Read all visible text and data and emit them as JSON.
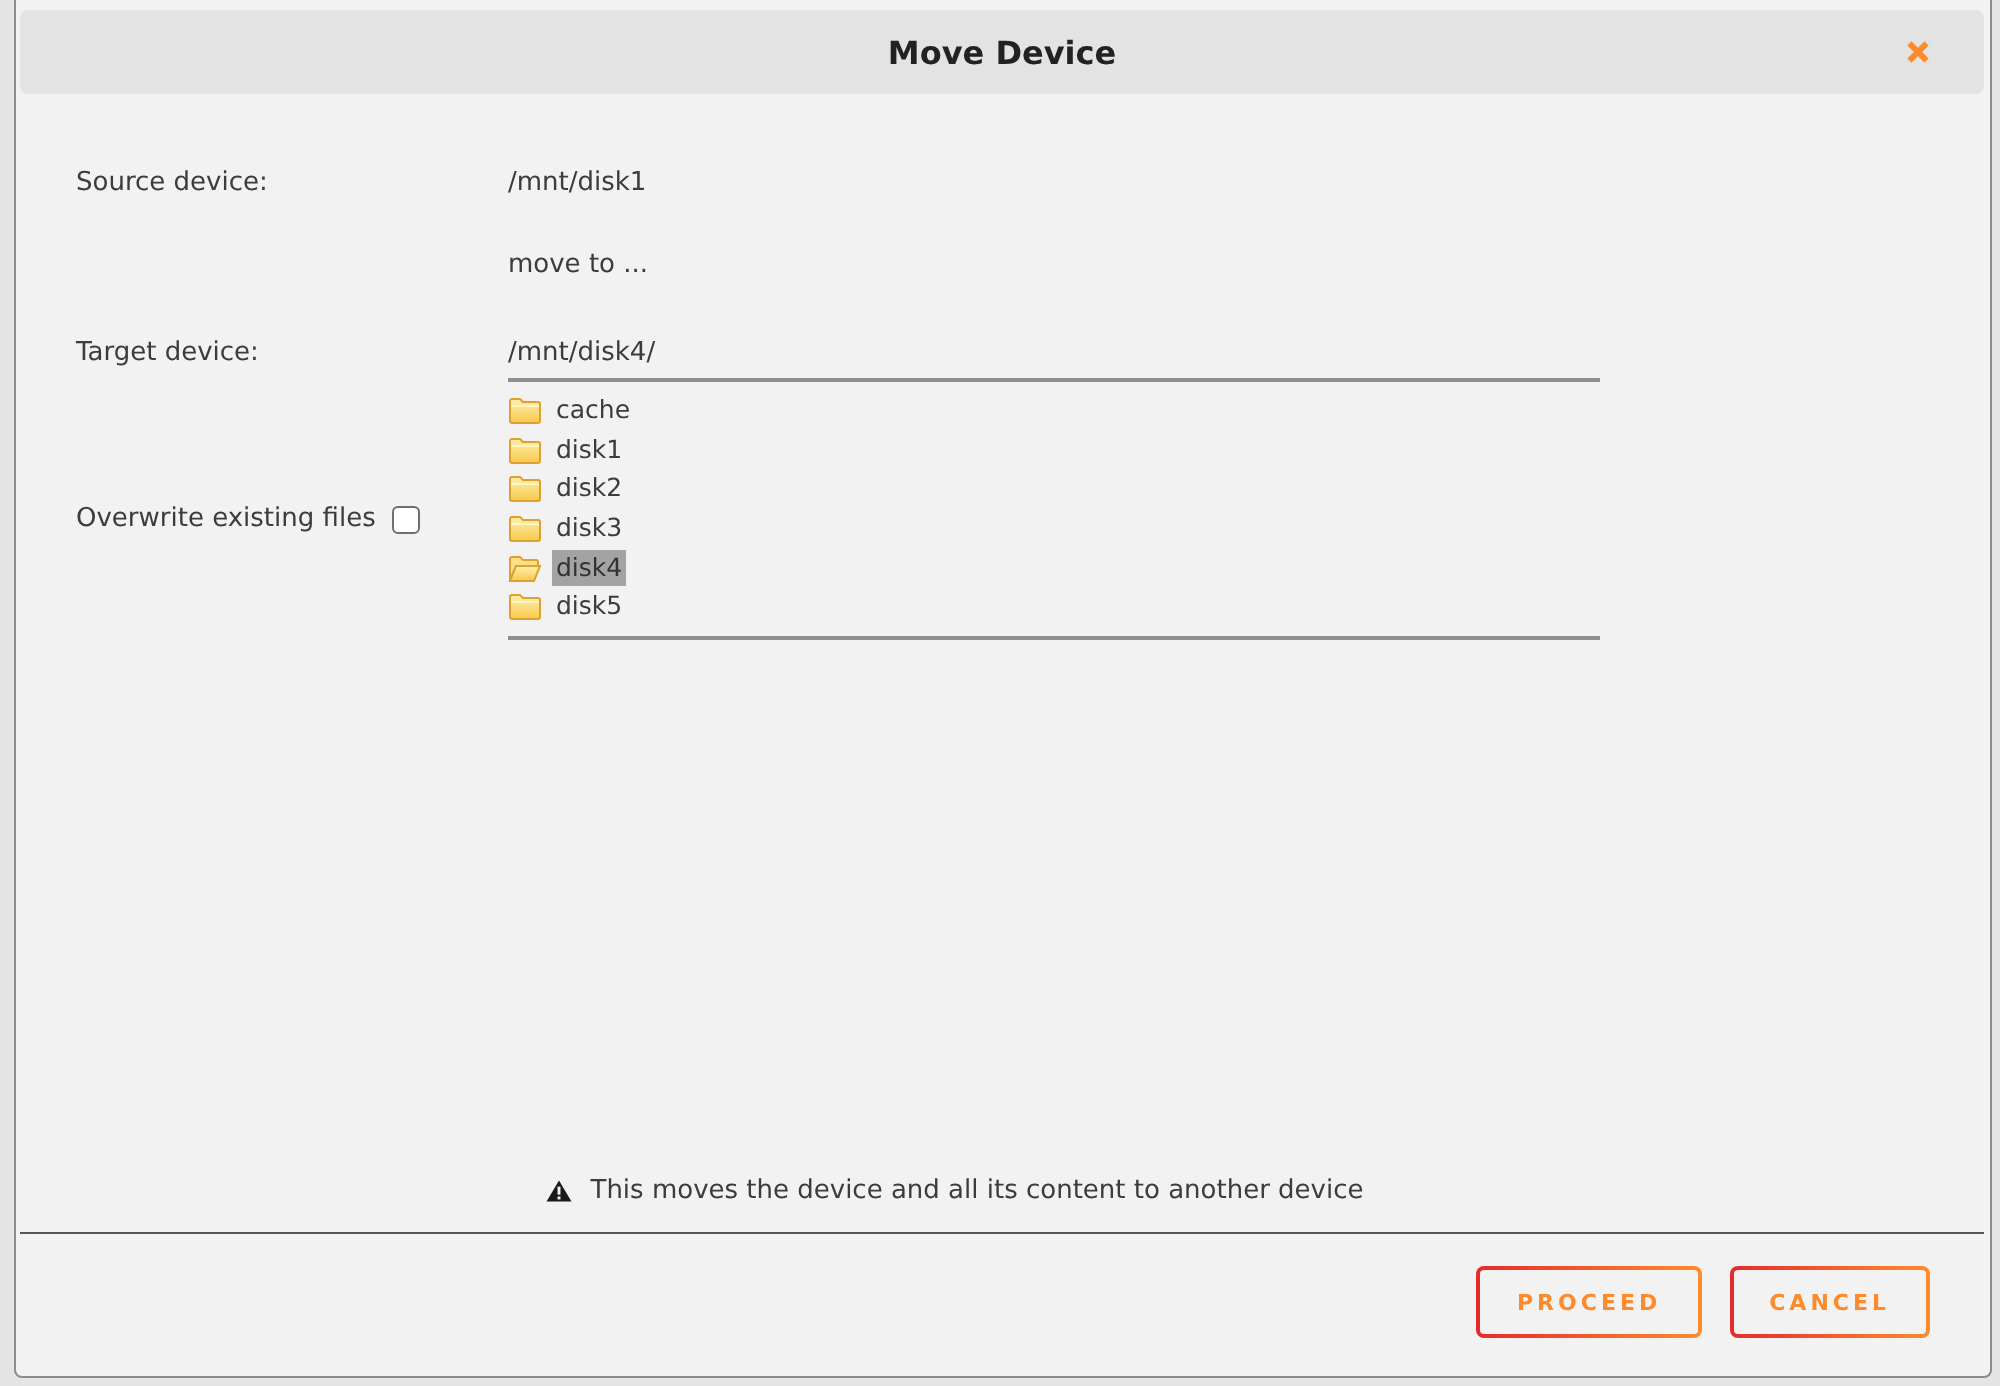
{
  "dialog": {
    "title": "Move Device"
  },
  "source": {
    "label": "Source device:",
    "value": "/mnt/disk1"
  },
  "move_hint": "move to ...",
  "target": {
    "label": "Target device:",
    "value": "/mnt/disk4/"
  },
  "tree": [
    {
      "name": "cache",
      "selected": false
    },
    {
      "name": "disk1",
      "selected": false
    },
    {
      "name": "disk2",
      "selected": false
    },
    {
      "name": "disk3",
      "selected": false
    },
    {
      "name": "disk4",
      "selected": true
    },
    {
      "name": "disk5",
      "selected": false
    }
  ],
  "overwrite": {
    "label": "Overwrite existing files",
    "checked": false
  },
  "warning": "This moves the device and all its content to another device",
  "buttons": [
    {
      "label": "PROCEED"
    },
    {
      "label": "CANCEL"
    }
  ]
}
